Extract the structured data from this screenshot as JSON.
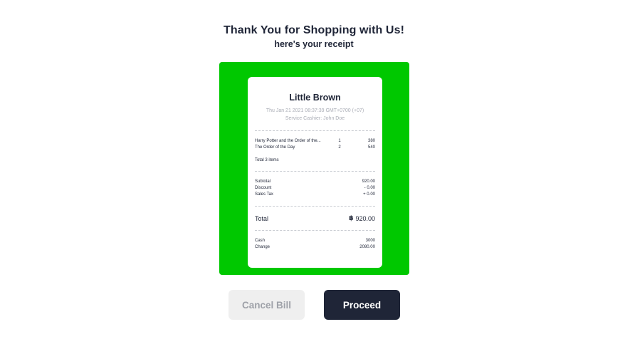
{
  "header": {
    "title": "Thank You for Shopping with Us!",
    "subtitle": "here's your receipt"
  },
  "colors": {
    "frame": "#00c800",
    "primary": "#1f2537",
    "muted": "#a9acb5",
    "cancel_bg": "#efefef",
    "cancel_text": "#9ea1a8"
  },
  "receipt": {
    "store_name": "Little Brown",
    "date": "Thu Jan 21 2021 08:37:39 GMT+0700 (+07)",
    "cashier": "Service Cashier: John Doe",
    "items": [
      {
        "name": "Harry Potter and the Order of the...",
        "qty": "1",
        "price": "380"
      },
      {
        "name": "The Order of the Day",
        "qty": "2",
        "price": "540"
      }
    ],
    "total_items": "Total 3 items",
    "summary": {
      "subtotal_label": "Subtotal",
      "subtotal_value": "920.00",
      "discount_label": "Discount",
      "discount_value": "- 0.00",
      "tax_label": "Sales Tax",
      "tax_value": "+ 0.00"
    },
    "total": {
      "label": "Total",
      "currency_symbol": "฿",
      "value": "920.00"
    },
    "payment": {
      "cash_label": "Cash",
      "cash_value": "3000",
      "change_label": "Change",
      "change_value": "2080.00"
    }
  },
  "actions": {
    "cancel_label": "Cancel Bill",
    "proceed_label": "Proceed"
  }
}
